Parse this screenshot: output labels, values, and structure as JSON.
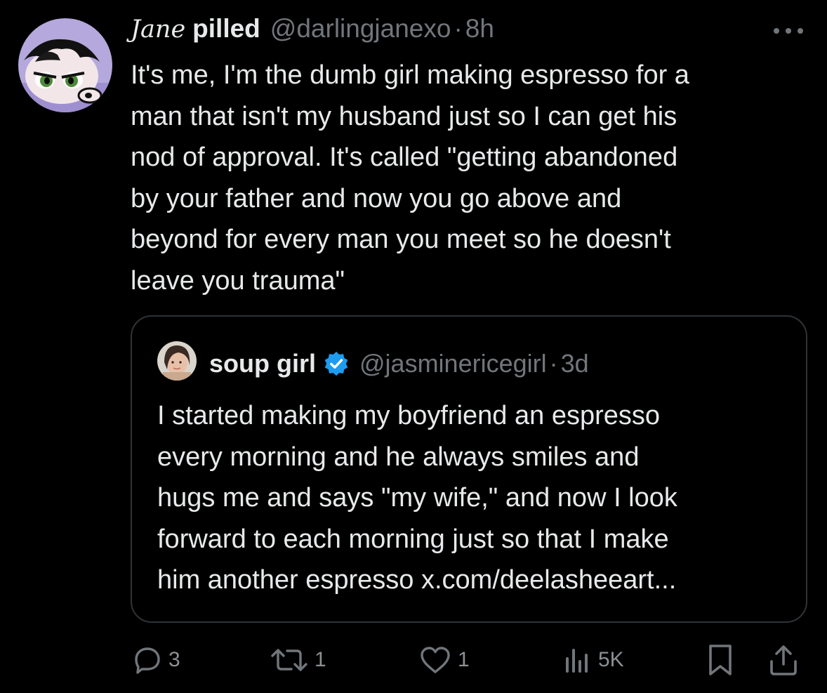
{
  "post": {
    "author_script_name": "Jane",
    "author_bold_name": "pilled",
    "handle": "@darlingjanexo",
    "separator": "·",
    "time": "8h",
    "more_icon": "more-horizontal-icon",
    "text_lines": [
      "It's me, I'm the dumb girl making espresso for a",
      "man that isn't my husband just so I can get his",
      "nod of approval. It's called \"getting abandoned",
      "by your father and now you go above and",
      "beyond for every man you meet so he doesn't",
      "leave you trauma\""
    ]
  },
  "quoted": {
    "name": "soup girl",
    "verified_icon": "verified-badge-icon",
    "handle": "@jasminericegirl",
    "separator": "·",
    "time": "3d",
    "text_lines": [
      "I started making my boyfriend an espresso",
      "every morning and he always smiles and",
      "hugs me and says \"my wife,\" and now I look",
      "forward to each morning just so that I make",
      "him another espresso x.com/deelasheeart..."
    ]
  },
  "actions": {
    "reply_count": "3",
    "repost_count": "1",
    "like_count": "1",
    "views_count": "5K"
  },
  "colors": {
    "background": "#000000",
    "text_primary": "#e7e9ea",
    "text_secondary": "#71767b",
    "border": "#2f3336",
    "verified_blue": "#1d9bf0",
    "avatar_purple": "#b5a8dc"
  }
}
